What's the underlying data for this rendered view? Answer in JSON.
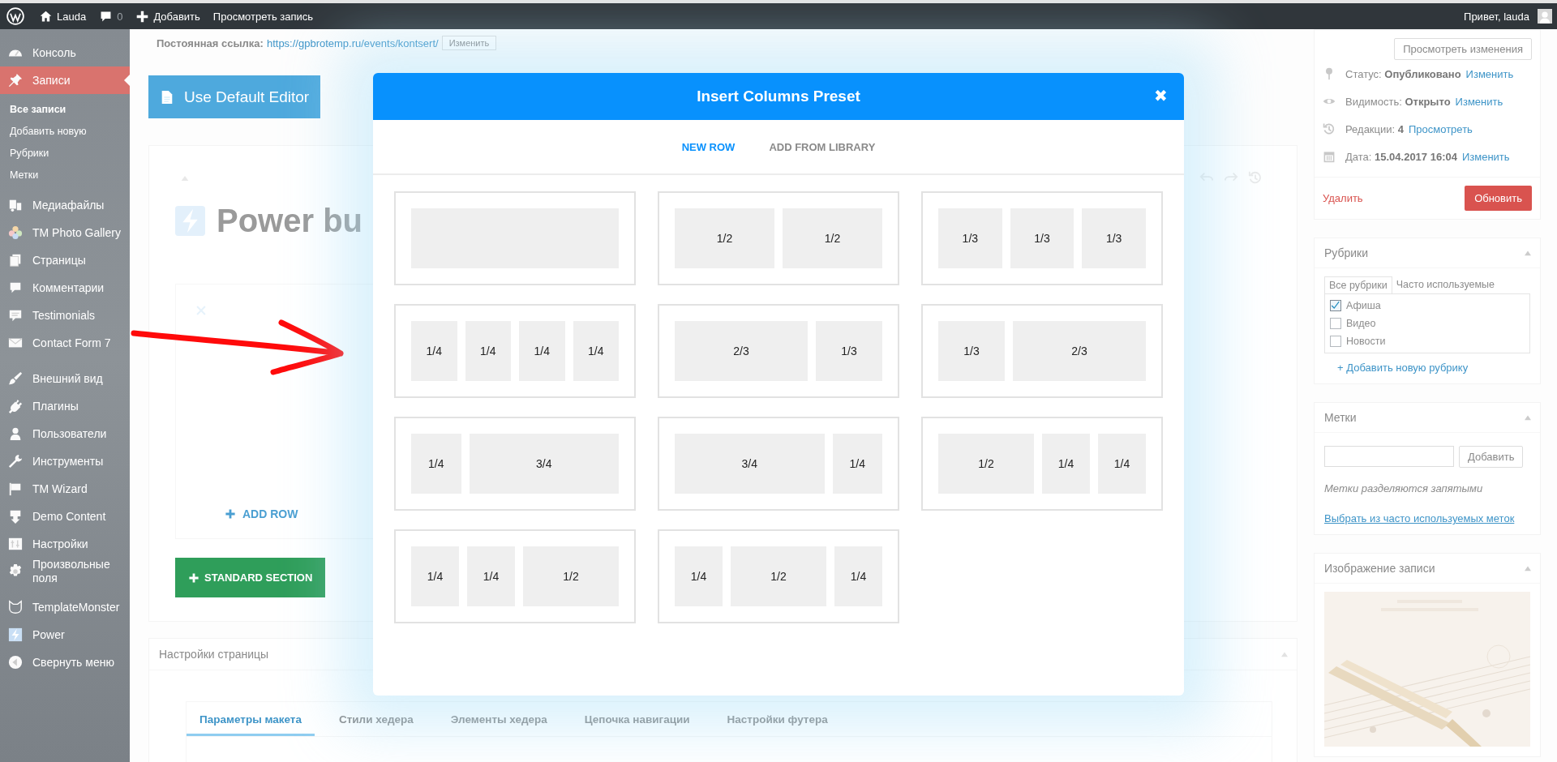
{
  "admin_bar": {
    "items": [
      {
        "kind": "logo"
      },
      {
        "kind": "home",
        "label": "Lauda"
      },
      {
        "kind": "comments",
        "label": "0"
      },
      {
        "kind": "new",
        "label": "Добавить"
      },
      {
        "kind": "link",
        "label": "Просмотреть запись"
      }
    ],
    "greeting": "Привет, lauda"
  },
  "sidebar": {
    "groups": [
      {
        "items": [
          {
            "kind": "gauge",
            "label": "Консоль",
            "selected": false
          },
          {
            "kind": "pin",
            "label": "Записи",
            "selected": true,
            "children": [
              {
                "label": "Все записи",
                "selected": true
              },
              {
                "label": "Добавить новую",
                "selected": false
              },
              {
                "label": "Рубрики",
                "selected": false
              },
              {
                "label": "Метки",
                "selected": false
              }
            ]
          },
          {
            "kind": "media",
            "label": "Медиафайлы",
            "selected": false
          },
          {
            "kind": "gallery",
            "label": "TM Photo Gallery",
            "selected": false
          },
          {
            "kind": "pages",
            "label": "Страницы",
            "selected": false
          },
          {
            "kind": "comments",
            "label": "Комментарии",
            "selected": false
          },
          {
            "kind": "testimonials",
            "label": "Testimonials",
            "selected": false
          },
          {
            "kind": "mail",
            "label": "Contact Form 7",
            "selected": false
          }
        ]
      },
      {
        "items": [
          {
            "kind": "appearance",
            "label": "Внешний вид",
            "selected": false
          },
          {
            "kind": "plugins",
            "label": "Плагины",
            "selected": false
          },
          {
            "kind": "users",
            "label": "Пользователи",
            "selected": false
          },
          {
            "kind": "tools",
            "label": "Инструменты",
            "selected": false
          },
          {
            "kind": "wizard",
            "label": "TM Wizard",
            "selected": false
          },
          {
            "kind": "demo",
            "label": "Demo Content",
            "selected": false
          },
          {
            "kind": "settings",
            "label": "Настройки",
            "selected": false
          },
          {
            "kind": "fields",
            "label": "Произвольные поля",
            "selected": false
          }
        ]
      },
      {
        "items": [
          {
            "kind": "monster",
            "label": "TemplateMonster",
            "selected": false
          },
          {
            "kind": "power",
            "label": "Power",
            "selected": false
          },
          {
            "kind": "collapse",
            "label": "Свернуть меню",
            "selected": false
          }
        ]
      }
    ]
  },
  "permalink": {
    "label": "Постоянная ссылка:",
    "url": "https://gpbrotemp.ru/events/kontsert/",
    "button": "Изменить"
  },
  "editor_button": "Use Default Editor",
  "builder": {
    "title": "Power bu",
    "add_row": "ADD ROW",
    "section_button": "STANDARD SECTION"
  },
  "page_settings": {
    "title": "Настройки страницы",
    "tabs": [
      {
        "label": "Параметры макета",
        "selected": true
      },
      {
        "label": "Стили хедера",
        "selected": false
      },
      {
        "label": "Элементы хедера",
        "selected": false
      },
      {
        "label": "Цепочка навигации",
        "selected": false
      },
      {
        "label": "Настройки футера",
        "selected": false
      }
    ]
  },
  "publish": {
    "preview_button": "Просмотреть изменения",
    "rows": [
      {
        "kind": "status",
        "text": "Статус: **Опубликовано**",
        "link": "Изменить"
      },
      {
        "kind": "visibility",
        "text": "Видимость: **Открыто**",
        "link": "Изменить"
      },
      {
        "kind": "revisions",
        "text": "Редакции: **4**",
        "link": "Просмотреть"
      },
      {
        "kind": "date",
        "text": "Дата: **15.04.2017 16:04**",
        "link": "Изменить"
      }
    ],
    "delete": "Удалить",
    "update": "Обновить"
  },
  "categories": {
    "title": "Рубрики",
    "tabs": [
      {
        "label": "Все рубрики",
        "selected": true
      },
      {
        "label": "Часто используемые",
        "selected": false
      }
    ],
    "items": [
      {
        "label": "Афиша",
        "checked": true
      },
      {
        "label": "Видео",
        "checked": false
      },
      {
        "label": "Новости",
        "checked": false
      }
    ],
    "add_link": "+ Добавить новую рубрику"
  },
  "tags": {
    "title": "Метки",
    "button": "Добавить",
    "hint": "Метки разделяются запятыми",
    "link": "Выбрать из часто используемых меток"
  },
  "featured_image": {
    "title": "Изображение записи"
  },
  "modal": {
    "title": "Insert Columns Preset",
    "close": "✖",
    "tabs": [
      {
        "label": "NEW ROW",
        "selected": true
      },
      {
        "label": "ADD FROM LIBRARY",
        "selected": false
      }
    ],
    "presets": [
      {
        "columns": [
          {
            "kind": "full"
          }
        ]
      },
      {
        "columns": [
          {
            "kind": "half",
            "label": "1/2"
          },
          {
            "kind": "half",
            "label": "1/2"
          }
        ]
      },
      {
        "columns": [
          {
            "kind": "third",
            "label": "1/3"
          },
          {
            "kind": "third",
            "label": "1/3"
          },
          {
            "kind": "third",
            "label": "1/3"
          }
        ]
      },
      {
        "columns": [
          {
            "kind": "quarter",
            "label": "1/4"
          },
          {
            "kind": "quarter",
            "label": "1/4"
          },
          {
            "kind": "quarter",
            "label": "1/4"
          },
          {
            "kind": "quarter",
            "label": "1/4"
          }
        ]
      },
      {
        "columns": [
          {
            "kind": "two_thirds",
            "label": "2/3"
          },
          {
            "kind": "third",
            "label": "1/3"
          }
        ]
      },
      {
        "columns": [
          {
            "kind": "third",
            "label": "1/3"
          },
          {
            "kind": "two_thirds",
            "label": "2/3"
          }
        ]
      },
      {
        "columns": [
          {
            "kind": "quarter",
            "label": "1/4"
          },
          {
            "kind": "three_quarters",
            "label": "3/4"
          }
        ]
      },
      {
        "columns": [
          {
            "kind": "three_quarters",
            "label": "3/4"
          },
          {
            "kind": "quarter",
            "label": "1/4"
          }
        ]
      },
      {
        "columns": [
          {
            "kind": "half",
            "label": "1/2"
          },
          {
            "kind": "quarter",
            "label": "1/4"
          },
          {
            "kind": "quarter",
            "label": "1/4"
          }
        ]
      },
      {
        "columns": [
          {
            "kind": "quarter",
            "label": "1/4"
          },
          {
            "kind": "quarter",
            "label": "1/4"
          },
          {
            "kind": "half",
            "label": "1/2"
          }
        ]
      },
      {
        "columns": [
          {
            "kind": "quarter",
            "label": "1/4"
          },
          {
            "kind": "half",
            "label": "1/2"
          },
          {
            "kind": "quarter",
            "label": "1/4"
          }
        ]
      }
    ]
  }
}
